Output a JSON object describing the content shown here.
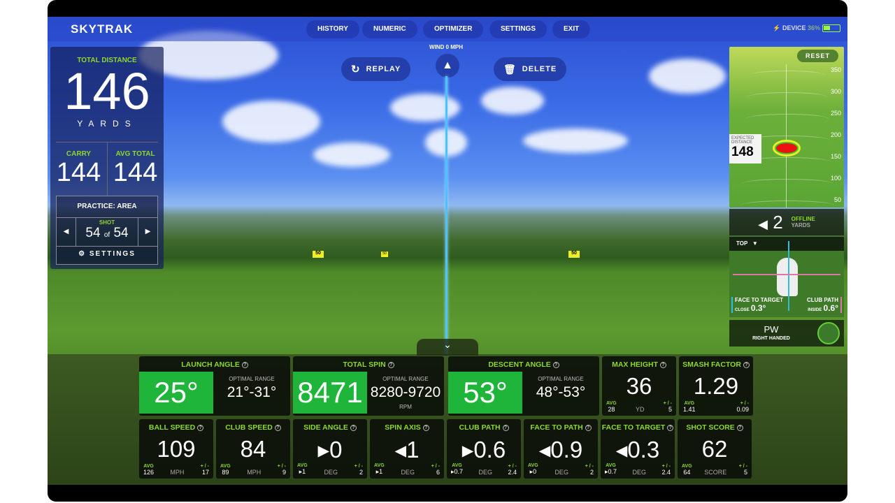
{
  "app": {
    "logo": "SKYTRAK"
  },
  "nav": [
    "HISTORY",
    "NUMERIC",
    "OPTIMIZER",
    "SETTINGS",
    "EXIT"
  ],
  "device": {
    "label": "DEVICE",
    "battery": "36%",
    "battery_level": 36
  },
  "wind": "WIND 0 MPH",
  "replay": "REPLAY",
  "delete": "DELETE",
  "left": {
    "total_label": "TOTAL DISTANCE",
    "total": "146",
    "unit": "YARDS",
    "carry_label": "CARRY",
    "carry": "144",
    "avg_label": "AVG TOTAL",
    "avg": "144",
    "mode": "PRACTICE: AREA",
    "shot_label": "SHOT",
    "shot": "54",
    "of": "of",
    "shot_total": "54",
    "settings": "SETTINGS"
  },
  "right": {
    "reset": "RESET",
    "ticks": [
      "350",
      "300",
      "250",
      "200",
      "150",
      "100",
      "50"
    ],
    "expected_label1": "EXPECTED",
    "expected_label2": "DISTANCE",
    "expected": "148",
    "offline": "2",
    "offline_label": "OFFLINE",
    "offline_unit": "YARDS",
    "view": "TOP",
    "ftt_label": "FACE TO TARGET",
    "ftt_dir": "CLOSE",
    "ftt": "0.3°",
    "cp_label": "CLUB PATH",
    "cp_dir": "INSIDE",
    "cp": "0.6°",
    "club": "PW",
    "hand": "RIGHT HANDED"
  },
  "range_markers": [
    "50",
    "50",
    "50"
  ],
  "top_metrics": [
    {
      "label": "LAUNCH ANGLE",
      "value": "25°",
      "opt_label": "OPTIMAL RANGE",
      "opt": "21°-31°",
      "opt_unit": ""
    },
    {
      "label": "TOTAL SPIN",
      "value": "8471",
      "opt_label": "OPTIMAL RANGE",
      "opt": "8280-9720",
      "opt_unit": "RPM"
    },
    {
      "label": "DESCENT ANGLE",
      "value": "53°",
      "opt_label": "OPTIMAL RANGE",
      "opt": "48°-53°",
      "opt_unit": ""
    }
  ],
  "small_metrics": [
    {
      "label": "MAX HEIGHT",
      "value": "36",
      "avg": "28",
      "unit": "YD",
      "pm": "5"
    },
    {
      "label": "SMASH FACTOR",
      "value": "1.29",
      "avg": "1.41",
      "unit": "",
      "pm": "0.09"
    }
  ],
  "avg_label": "AVG",
  "pm_label": "+ / -",
  "bottom_metrics": [
    {
      "label": "BALL SPEED",
      "value": "109",
      "avg": "126",
      "unit": "MPH",
      "pm": "17"
    },
    {
      "label": "CLUB SPEED",
      "value": "84",
      "avg": "89",
      "unit": "MPH",
      "pm": "9"
    },
    {
      "label": "SIDE ANGLE",
      "value": "▸0",
      "avg": "▸1",
      "unit": "DEG",
      "pm": "2"
    },
    {
      "label": "SPIN AXIS",
      "value": "◂1",
      "avg": "▸1",
      "unit": "DEG",
      "pm": "6"
    },
    {
      "label": "CLUB PATH",
      "value": "▸0.6",
      "avg": "▸0.7",
      "unit": "DEG",
      "pm": "2.4"
    },
    {
      "label": "FACE TO PATH",
      "value": "◂0.9",
      "avg": "▸0",
      "unit": "DEG",
      "pm": "2"
    },
    {
      "label": "FACE TO TARGET",
      "value": "◂0.3",
      "avg": "▸0.7",
      "unit": "DEG",
      "pm": "2.4"
    },
    {
      "label": "SHOT SCORE",
      "value": "62",
      "avg": "64",
      "unit": "SCORE",
      "pm": "5"
    }
  ]
}
